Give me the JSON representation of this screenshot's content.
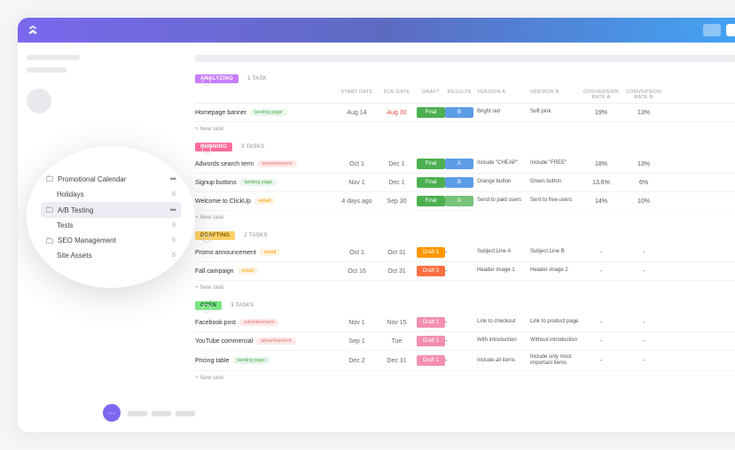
{
  "popover": {
    "items": [
      {
        "label": "Promotional Calendar",
        "count": "•••",
        "folder": true
      },
      {
        "label": "Holidays",
        "count": "6",
        "sub": true
      },
      {
        "label": "A/B Testing",
        "count": "•••",
        "folder": true,
        "active": true
      },
      {
        "label": "Tests",
        "count": "9",
        "sub": true
      },
      {
        "label": "SEO Management",
        "count": "6",
        "folder": true
      },
      {
        "label": "Site Assets",
        "count": "6",
        "sub": true
      }
    ]
  },
  "headers": {
    "start": "START DATE",
    "due": "DUE DATE",
    "draft": "DRAFT",
    "results": "RESULTS",
    "va": "VERSION A",
    "vb": "VERSION B",
    "cra": "CONVERSION RATE A",
    "crb": "CONVERSION RATE B"
  },
  "sections": [
    {
      "status": "ANALYZING",
      "statusClass": "p-analyzing",
      "count": "1 TASK",
      "tasks": [
        {
          "name": "Homepage banner",
          "tag": "landing page",
          "tagClass": "tag-lp",
          "sd": "Aug 14",
          "dd": "Aug 30",
          "due": true,
          "draft": "Final",
          "draftClass": "pc-final",
          "res": "B",
          "resClass": "pc-b",
          "va": "Bright red",
          "vb": "Soft pink",
          "cra": "19%",
          "crb": "13%"
        }
      ]
    },
    {
      "status": "RUNNING",
      "statusClass": "p-running",
      "count": "3 TASKS",
      "tasks": [
        {
          "name": "Adwords search term",
          "tag": "advertisement",
          "tagClass": "tag-ad",
          "sd": "Oct 1",
          "dd": "Dec 1",
          "draft": "Final",
          "draftClass": "pc-final",
          "res": "A",
          "resClass": "pc-b",
          "va": "Include \"CHEAP\"",
          "vb": "Include \"FREE\"",
          "cra": "18%",
          "crb": "13%"
        },
        {
          "name": "Signup buttons",
          "tag": "landing page",
          "tagClass": "tag-lp",
          "sd": "Nov 1",
          "dd": "Dec 1",
          "draft": "Final",
          "draftClass": "pc-final",
          "res": "B",
          "resClass": "pc-b",
          "va": "Orange button",
          "vb": "Green button",
          "cra": "13.6%",
          "crb": "6%"
        },
        {
          "name": "Welcome to ClickUp",
          "tag": "email",
          "tagClass": "tag-em",
          "sd": "4 days ago",
          "dd": "Sep 30",
          "draft": "Final",
          "draftClass": "pc-final",
          "res": "A",
          "resClass": "pc-a",
          "va": "Send to paid users",
          "vb": "Sent to free users",
          "cra": "14%",
          "crb": "10%"
        }
      ]
    },
    {
      "status": "DRAFTING",
      "statusClass": "p-drafting",
      "count": "2 TASKS",
      "tasks": [
        {
          "name": "Promo announcement",
          "tag": "email",
          "tagClass": "tag-em",
          "sd": "Oct 1",
          "dd": "Oct 31",
          "draft": "Draft 1",
          "draftClass": "pc-d1",
          "res": "-",
          "va": "Subject Line A",
          "vb": "Subject Line B",
          "cra": "-",
          "crb": "-"
        },
        {
          "name": "Fall campaign",
          "tag": "email",
          "tagClass": "tag-em",
          "sd": "Oct 16",
          "dd": "Oct 31",
          "draft": "Draft 3",
          "draftClass": "pc-d3",
          "res": "-",
          "va": "Header image 1",
          "vb": "Header image 2",
          "cra": "-",
          "crb": "-"
        }
      ]
    },
    {
      "status": "OPEN",
      "statusClass": "p-open",
      "count": "3 TASKS",
      "tasks": [
        {
          "name": "Facebook post",
          "tag": "advertisement",
          "tagClass": "tag-ad",
          "sd": "Nov 1",
          "dd": "Nov 15",
          "draft": "Draft 1",
          "draftClass": "pc-pink",
          "res": "-",
          "va": "Link to checkout",
          "vb": "Link to product page",
          "cra": "-",
          "crb": "-"
        },
        {
          "name": "YouTube commercial",
          "tag": "advertisement",
          "tagClass": "tag-ad",
          "sd": "Sep 1",
          "dd": "Tue",
          "draft": "Draft 1",
          "draftClass": "pc-pink",
          "res": "-",
          "va": "With introduction",
          "vb": "Without introduction",
          "cra": "-",
          "crb": "-"
        },
        {
          "name": "Pricing table",
          "tag": "landing page",
          "tagClass": "tag-lp",
          "sd": "Dec 2",
          "dd": "Dec 31",
          "draft": "Draft 1",
          "draftClass": "pc-pink",
          "res": "-",
          "va": "Include all items",
          "vb": "Include only most important items",
          "cra": "-",
          "crb": "-"
        }
      ]
    }
  ],
  "newTask": "New task"
}
